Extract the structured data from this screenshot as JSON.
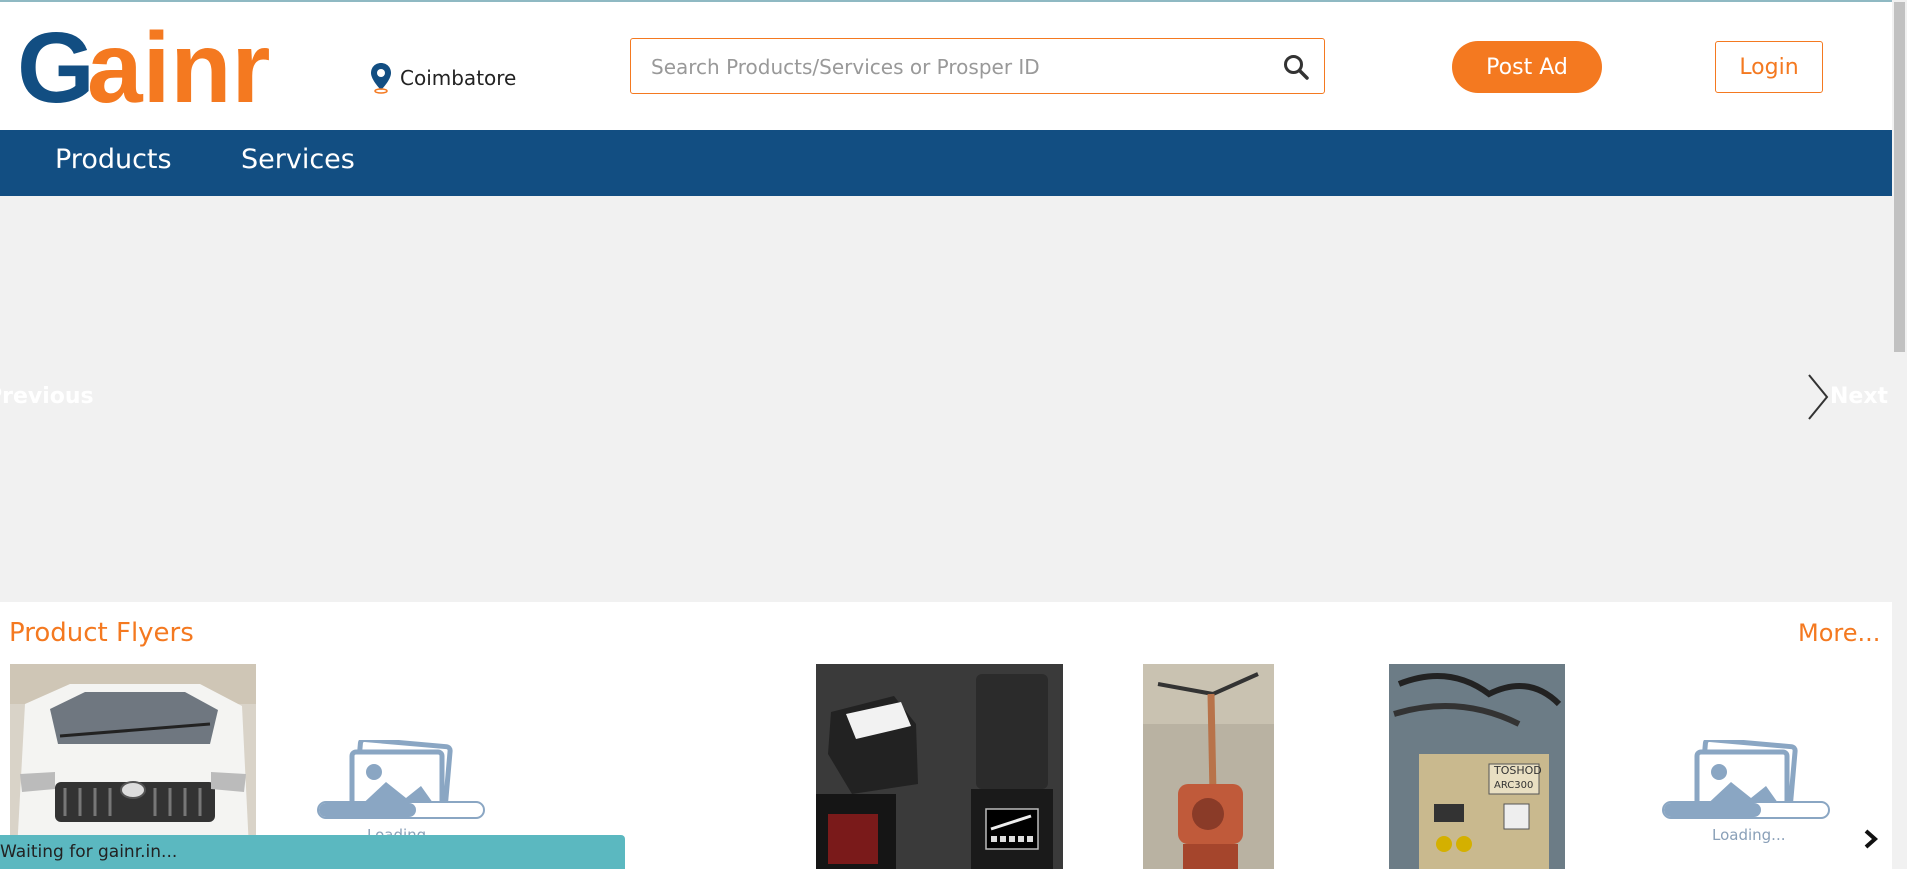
{
  "header": {
    "logo_text": "Gainr",
    "location": "Coimbatore",
    "search_placeholder": "Search Products/Services or Prosper ID",
    "post_ad_label": "Post Ad",
    "login_label": "Login"
  },
  "nav": {
    "items": [
      {
        "label": "Products"
      },
      {
        "label": "Services"
      }
    ]
  },
  "carousel": {
    "prev_label": "Previous",
    "next_label": "Next"
  },
  "flyers": {
    "title": "Product Flyers",
    "more_label": "More...",
    "loading_label": "Loading..."
  },
  "status_bar": {
    "text": "Waiting for gainr.in..."
  },
  "colors": {
    "brand_orange": "#f47920",
    "brand_blue": "#124e82",
    "carousel_bg": "#f1f1f1",
    "status_bg": "#5bb8c0"
  },
  "icons": [
    "map-pin-icon",
    "search-icon",
    "chevron-right-icon",
    "image-placeholder-icon"
  ]
}
